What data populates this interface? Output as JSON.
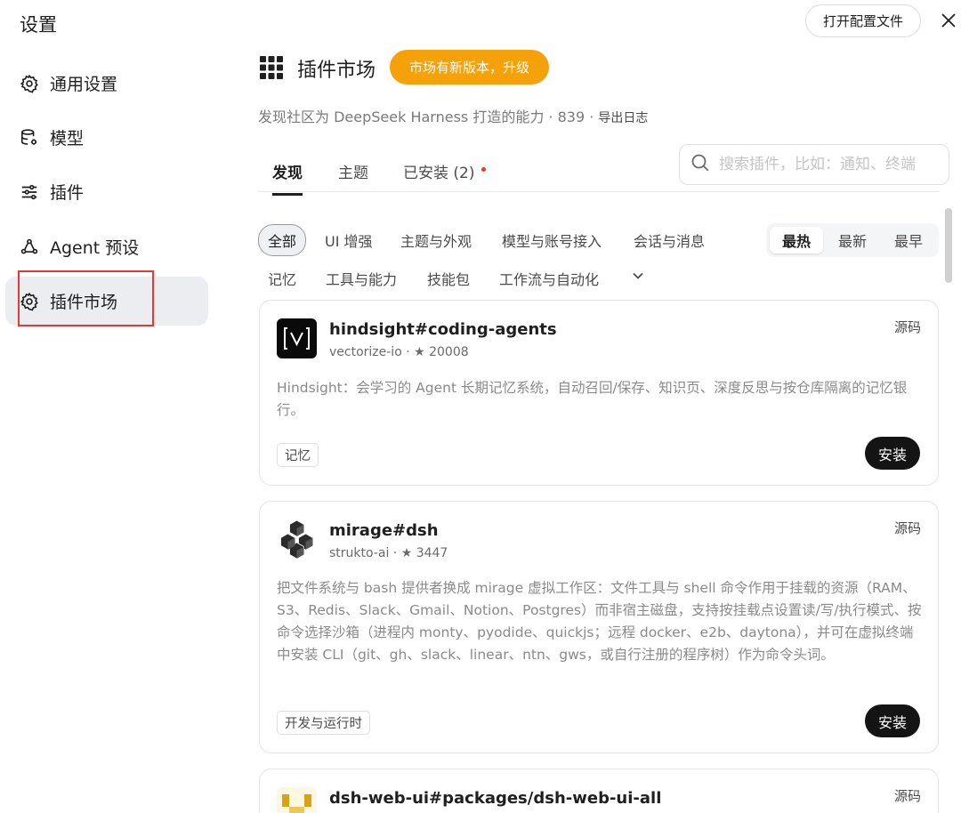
{
  "sidebar": {
    "title": "设置",
    "items": [
      {
        "label": "通用设置",
        "icon": "gear-icon"
      },
      {
        "label": "模型",
        "icon": "database-icon"
      },
      {
        "label": "插件",
        "icon": "sliders-icon"
      },
      {
        "label": "Agent 预设",
        "icon": "agent-icon"
      },
      {
        "label": "插件市场",
        "icon": "gear-icon"
      }
    ]
  },
  "topbar": {
    "open_config_label": "打开配置文件",
    "close_icon": "close-icon"
  },
  "header": {
    "title": "插件市场",
    "icon": "grid-icon",
    "upgrade_label": "市场有新版本，升级",
    "subtitle": "发现社区为 DeepSeek Harness 打造的能力 · 839 · ",
    "export_label": "导出日志"
  },
  "tabs": [
    {
      "label": "发现"
    },
    {
      "label": "主题"
    },
    {
      "label": "已安装 (2)"
    }
  ],
  "search": {
    "placeholder": "搜索插件，比如：通知、终端"
  },
  "filters": {
    "row1": [
      "全部",
      "UI 增强",
      "主题与外观",
      "模型与账号接入",
      "会话与消息"
    ],
    "row2": [
      "记忆",
      "工具与能力",
      "技能包",
      "工作流与自动化"
    ],
    "more_icon": "chevron-down-icon"
  },
  "sort": [
    "最热",
    "最新",
    "最早"
  ],
  "plugins": [
    {
      "name": "hindsight#coding-agents",
      "meta": "vectorize-io · ★ 20008",
      "source_label": "源码",
      "description": "Hindsight：会学习的 Agent 长期记忆系统，自动召回/保存、知识页、深度反思与按仓库隔离的记忆银行。",
      "tag": "记忆",
      "install_label": "安装"
    },
    {
      "name": "mirage#dsh",
      "meta": "strukto-ai · ★ 3447",
      "source_label": "源码",
      "description": "把文件系统与 bash 提供者换成 mirage 虚拟工作区：文件工具与 shell 命令作用于挂载的资源（RAM、S3、Redis、Slack、Gmail、Notion、Postgres）而非宿主磁盘，支持按挂载点设置读/写/执行模式、按命令选择沙箱（进程内 monty、pyodide、quickjs；远程 docker、e2b、daytona），并可在虚拟终端中安装 CLI（git、gh、slack、linear、ntn、gws，或自行注册的程序树）作为命令头词。",
      "tag": "开发与运行时",
      "install_label": "安装"
    },
    {
      "name": "dsh-web-ui#packages/dsh-web-ui-all",
      "source_label": "源码"
    }
  ],
  "colors": {
    "accent": "#f5a10a",
    "dark": "#141414",
    "highlight": "#e53935"
  }
}
